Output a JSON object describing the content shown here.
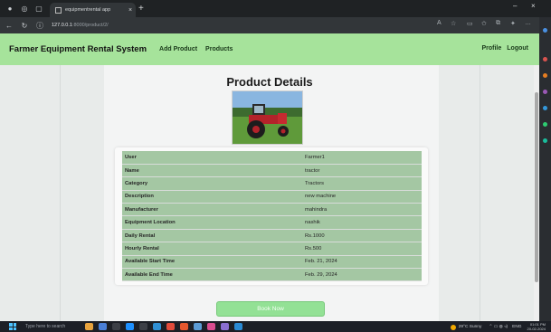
{
  "browser": {
    "tab_title": "equipmentrental app",
    "url_host": "127.0.0.1",
    "url_path": ":8000/product/2/",
    "new_tab": "+",
    "close_tab": "×"
  },
  "navbar": {
    "brand": "Farmer Equipment Rental System",
    "links": [
      "Add Product",
      "Products"
    ],
    "profile": "Profile",
    "logout": "Logout"
  },
  "product": {
    "title": "Product Details",
    "image_alt": "tractor",
    "details": [
      {
        "label": "User",
        "value": "Farmer1"
      },
      {
        "label": "Name",
        "value": "tractor"
      },
      {
        "label": "Category",
        "value": "Tractors"
      },
      {
        "label": "Description",
        "value": "new machine"
      },
      {
        "label": "Manufacturer",
        "value": "mahindra"
      },
      {
        "label": "Equipment Location",
        "value": "nashik"
      },
      {
        "label": "Daily Rental",
        "value": "Rs.1000"
      },
      {
        "label": "Hourly Rental",
        "value": "Rs.500"
      },
      {
        "label": "Available Start Time",
        "value": "Feb. 21, 2024"
      },
      {
        "label": "Available End Time",
        "value": "Feb. 29, 2024"
      }
    ],
    "book_button": "Book Now"
  },
  "taskbar": {
    "search_placeholder": "Type here to search",
    "weather": "29°C Sunny",
    "lang": "ENG",
    "time": "01:01 PM",
    "date": "20-02-2024"
  },
  "colors": {
    "navbar": "#a6e39b",
    "table_row": "#a4c7a3",
    "button": "#93e195"
  }
}
